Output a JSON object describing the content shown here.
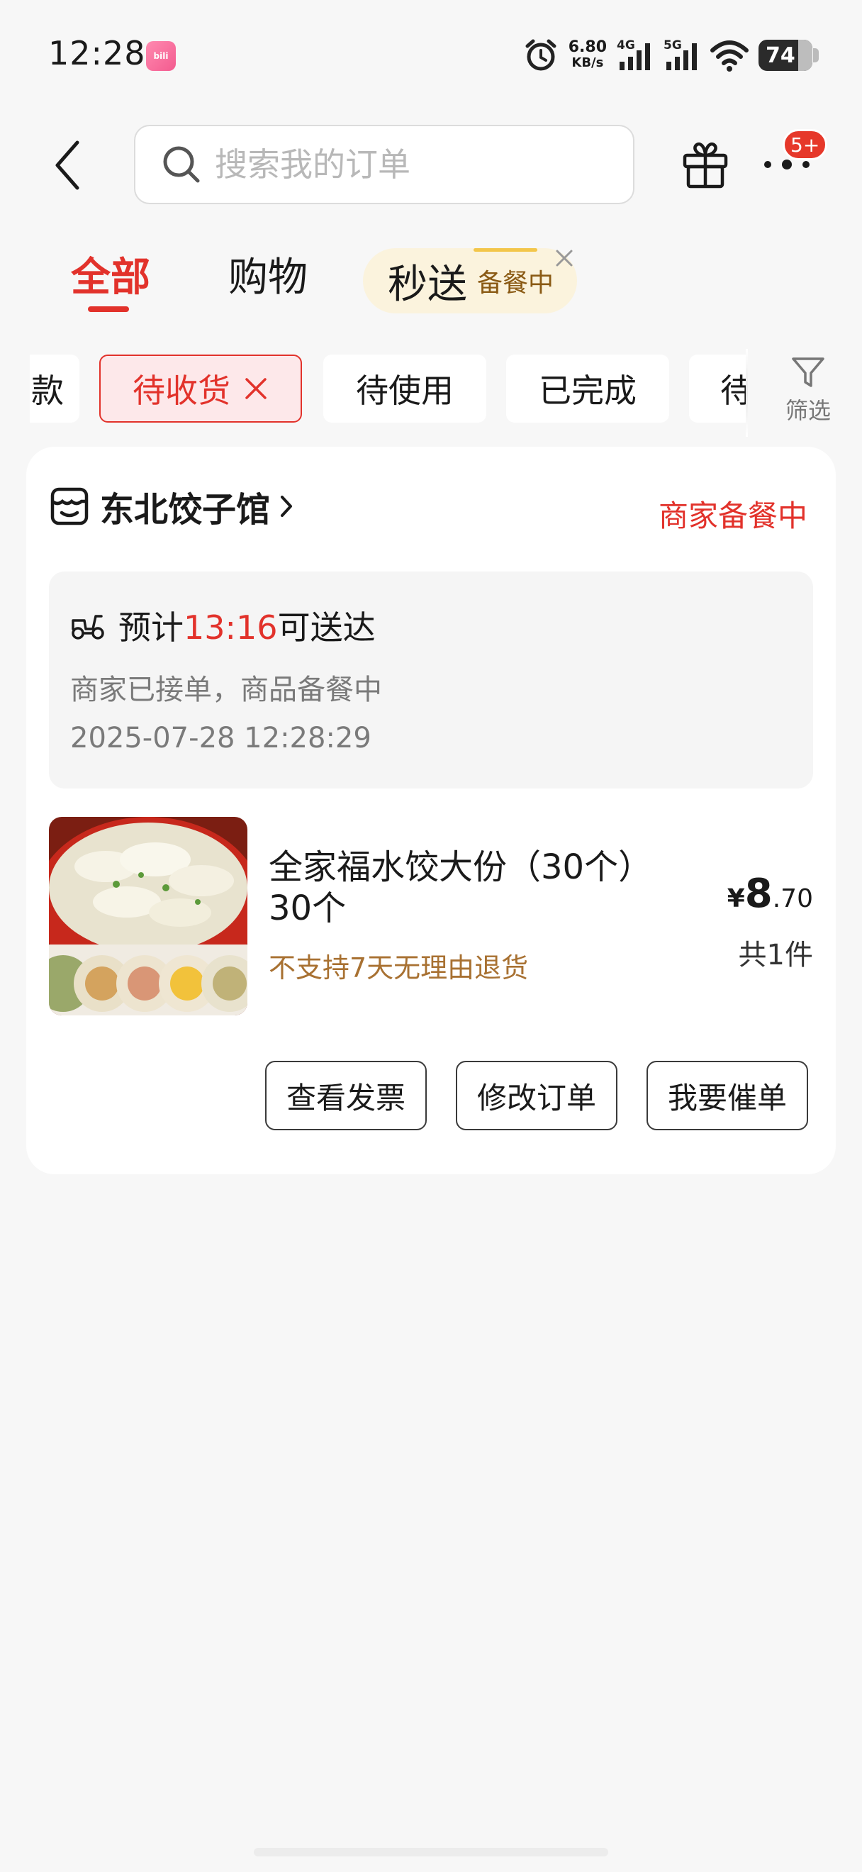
{
  "status_bar": {
    "time": "12:28",
    "app_icon": "bilibili",
    "net_speed_value": "6.80",
    "net_speed_unit": "KB/s",
    "sig1_label": "4G",
    "sig2_label": "5G",
    "battery": "74"
  },
  "header": {
    "search_placeholder": "搜索我的订单",
    "more_badge": "5+"
  },
  "tabs": {
    "all": "全部",
    "shop": "购物",
    "miaosong": "秒送",
    "miaosong_tag": "备餐中"
  },
  "filters": {
    "chip_partial_left": "款",
    "chip_active": "待收货",
    "chip_use": "待使用",
    "chip_done": "已完成",
    "chip_partial_right": "待",
    "filter_label": "筛选"
  },
  "order": {
    "shop_name": "东北饺子馆",
    "status": "商家备餐中",
    "eta_prefix": "预计",
    "eta_time": "13:16",
    "eta_suffix": "可送达",
    "message": "商家已接单，商品备餐中",
    "datetime": "2025-07-28 12:28:29",
    "product_name": "全家福水饺大份（30个）30个",
    "policy": "不支持7天无理由退货",
    "price_symbol": "¥",
    "price_int": "8",
    "price_dec": ".70",
    "quantity": "共1件",
    "buttons": {
      "invoice": "查看发票",
      "modify": "修改订单",
      "urge": "我要催单"
    }
  },
  "colors": {
    "accent": "#e2322b",
    "policy": "#a87132",
    "chip_active_bg": "#fde8ea",
    "miaosong_bg": "#fbf3dd"
  }
}
